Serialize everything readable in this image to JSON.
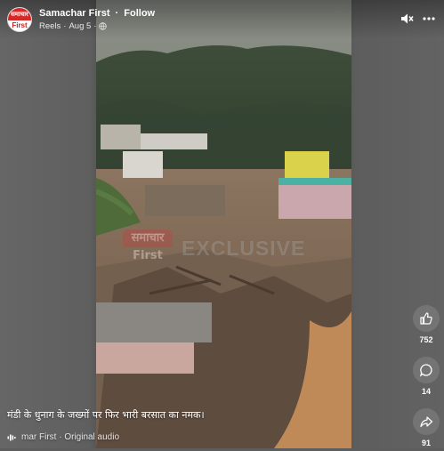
{
  "post": {
    "page_name": "Samachar First",
    "separator": "·",
    "follow_label": "Follow",
    "source": "Reels",
    "date": "Aug 5",
    "caption": "मंडी के धुनाग के जख्मों पर फिर भारी बरसात का नमक।",
    "audio": "mar First · Original audio"
  },
  "avatar": {
    "top_text": "समाचार",
    "bottom_text": "First"
  },
  "watermark": {
    "logo_top": "समाचार",
    "logo_bottom": "First",
    "text": "EXCLUSIVE"
  },
  "actions": {
    "like_count": "752",
    "comment_count": "14",
    "share_count": "91"
  },
  "icons": {
    "mute": "speaker-muted-icon",
    "more": "more-horizontal-icon",
    "like": "thumbs-up-icon",
    "comment": "comment-bubble-icon",
    "share": "share-arrow-icon",
    "audio": "audio-waveform-icon",
    "audience": "globe-icon"
  },
  "colors": {
    "brand_red": "#d62828",
    "action_bg": "#787878"
  }
}
